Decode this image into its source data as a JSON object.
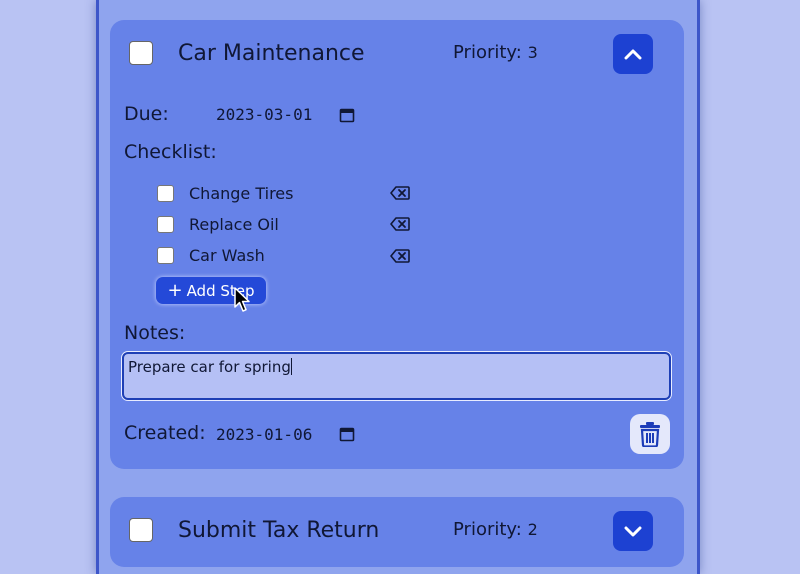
{
  "tasks": [
    {
      "title": "Car Maintenance",
      "priority_label": "Priority:",
      "priority_value": "3",
      "expanded": true,
      "due_label": "Due:",
      "due_value": "2023-03-01",
      "checklist_label": "Checklist:",
      "steps": [
        {
          "label": "Change Tires"
        },
        {
          "label": "Replace Oil"
        },
        {
          "label": "Car Wash"
        }
      ],
      "add_step_label": "Add Step",
      "notes_label": "Notes:",
      "notes_value": "Prepare car for spring",
      "created_label": "Created:",
      "created_value": "2023-01-06"
    },
    {
      "title": "Submit Tax Return",
      "priority_label": "Priority:",
      "priority_value": "2",
      "expanded": false
    }
  ],
  "colors": {
    "background": "#b9c3f3",
    "column": "#8fa4ee",
    "card": "#6682e8",
    "accent": "#1d41d2",
    "notes_bg": "#b5c0f5"
  },
  "icons": {
    "collapse": "chevron-up-icon",
    "expand": "chevron-down-icon",
    "calendar": "calendar-icon",
    "delete_step": "backspace-icon",
    "delete_task": "trash-icon",
    "add": "plus-icon",
    "cursor": "mouse-pointer-icon"
  }
}
